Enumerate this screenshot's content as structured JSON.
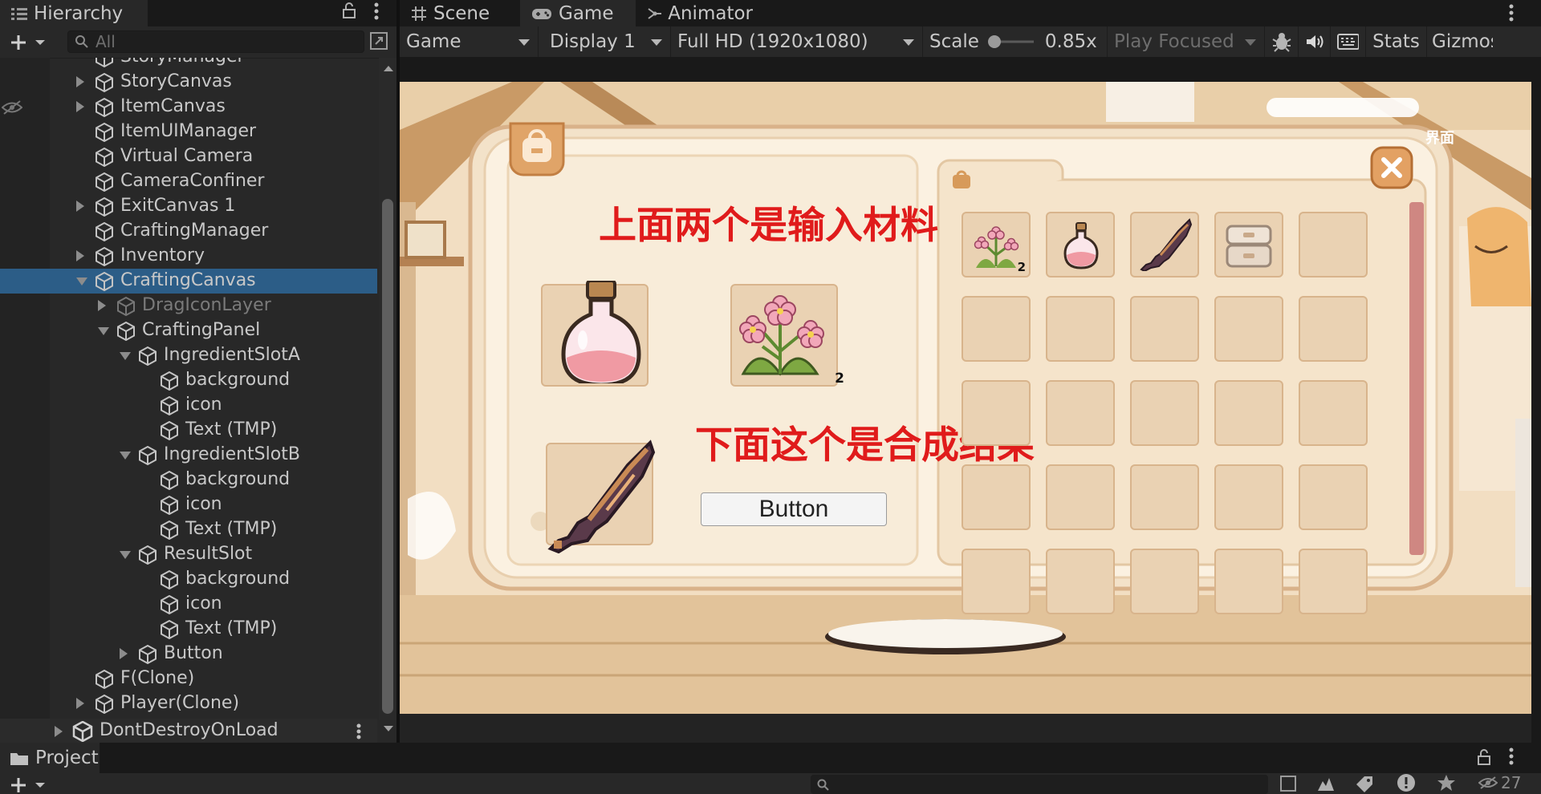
{
  "hierarchy": {
    "tab_title": "Hierarchy",
    "search_placeholder": "All",
    "items": [
      {
        "label": "StoryManager",
        "expandable": false
      },
      {
        "label": "StoryCanvas",
        "expandable": true
      },
      {
        "label": "ItemCanvas",
        "expandable": true
      },
      {
        "label": "ItemUIManager",
        "expandable": false
      },
      {
        "label": "Virtual Camera",
        "expandable": false
      },
      {
        "label": "CameraConfiner",
        "expandable": false
      },
      {
        "label": "ExitCanvas 1",
        "expandable": true
      },
      {
        "label": "CraftingManager",
        "expandable": false
      },
      {
        "label": "Inventory",
        "expandable": true
      },
      {
        "label": "CraftingCanvas",
        "expandable": true,
        "expanded": true,
        "selected": true
      },
      {
        "label": "DragIconLayer",
        "expandable": true,
        "dim": true
      },
      {
        "label": "CraftingPanel",
        "expandable": true,
        "expanded": true
      },
      {
        "label": "IngredientSlotA",
        "expandable": true,
        "expanded": true
      },
      {
        "label": "background"
      },
      {
        "label": "icon"
      },
      {
        "label": "Text (TMP)"
      },
      {
        "label": "IngredientSlotB",
        "expandable": true,
        "expanded": true
      },
      {
        "label": "background"
      },
      {
        "label": "icon"
      },
      {
        "label": "Text (TMP)"
      },
      {
        "label": "ResultSlot",
        "expandable": true,
        "expanded": true
      },
      {
        "label": "background"
      },
      {
        "label": "icon"
      },
      {
        "label": "Text (TMP)"
      },
      {
        "label": "Button",
        "expandable": true
      },
      {
        "label": "F(Clone)"
      },
      {
        "label": "Player(Clone)",
        "expandable": true
      }
    ],
    "scene_root": "DontDestroyOnLoad"
  },
  "game_panel": {
    "tabs": [
      "Scene",
      "Game",
      "Animator"
    ],
    "active_tab": "Game",
    "toolbar": {
      "mode": "Game",
      "display": "Display 1",
      "resolution": "Full HD (1920x1080)",
      "scale_label": "Scale",
      "scale_value": "0.85x",
      "play_mode": "Play Focused",
      "stats": "Stats",
      "gizmos": "Gizmos"
    }
  },
  "game_view": {
    "annotation_top": "上面两个是输入材料",
    "annotation_bottom": "下面这个是合成结果",
    "button_label": "Button",
    "corner_text": "界面",
    "ingredient_b_count": "2",
    "inventory": {
      "first_item_count": "2",
      "items": [
        "flower-bunch",
        "pink-potion",
        "pixel-dagger",
        "storage-box"
      ]
    }
  },
  "project": {
    "tab_title": "Project",
    "hidden_count": "27"
  }
}
